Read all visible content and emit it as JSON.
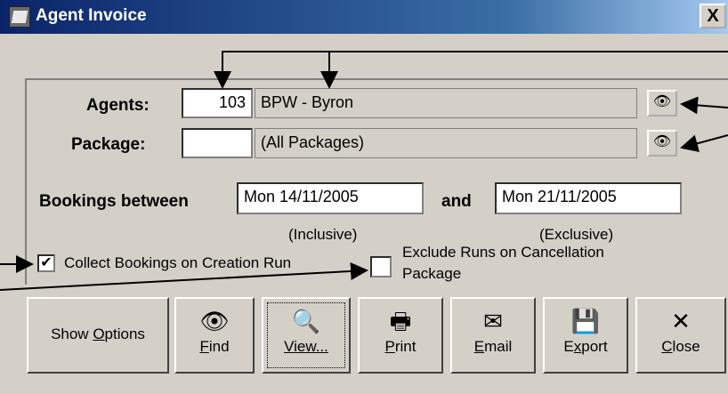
{
  "window": {
    "title": "Agent Invoice",
    "close_glyph": "X"
  },
  "agents": {
    "label": "Agents:",
    "code": "103",
    "name": "BPW - Byron"
  },
  "package": {
    "label": "Package:",
    "code": "",
    "name": "(All Packages)"
  },
  "bookings": {
    "label": "Bookings between",
    "from": "Mon 14/11/2005",
    "and_label": "and",
    "to": "Mon 21/11/2005",
    "from_note": "(Inclusive)",
    "to_note": "(Exclusive)"
  },
  "options": {
    "collect_label": "Collect Bookings on Creation Run",
    "collect_checked": true,
    "exclude_label_line1": "Exclude Runs on Cancellation",
    "exclude_label_line2": "Package",
    "exclude_checked": false
  },
  "toolbar": {
    "show_options": {
      "pre": "Show ",
      "key": "O",
      "post": "ptions"
    },
    "find": {
      "key": "F",
      "post": "ind",
      "icon": "binoculars-icon"
    },
    "view": {
      "key": "V",
      "post": "iew...",
      "icon": "preview-icon"
    },
    "print": {
      "key": "P",
      "post": "rint",
      "icon": "printer-icon"
    },
    "email": {
      "key": "E",
      "post": "mail",
      "icon": "email-icon"
    },
    "export": {
      "pre": "E",
      "key": "x",
      "post": "port",
      "icon": "floppy-disk-icon"
    },
    "close": {
      "key": "C",
      "post": "lose",
      "icon": "close-x-icon"
    }
  }
}
